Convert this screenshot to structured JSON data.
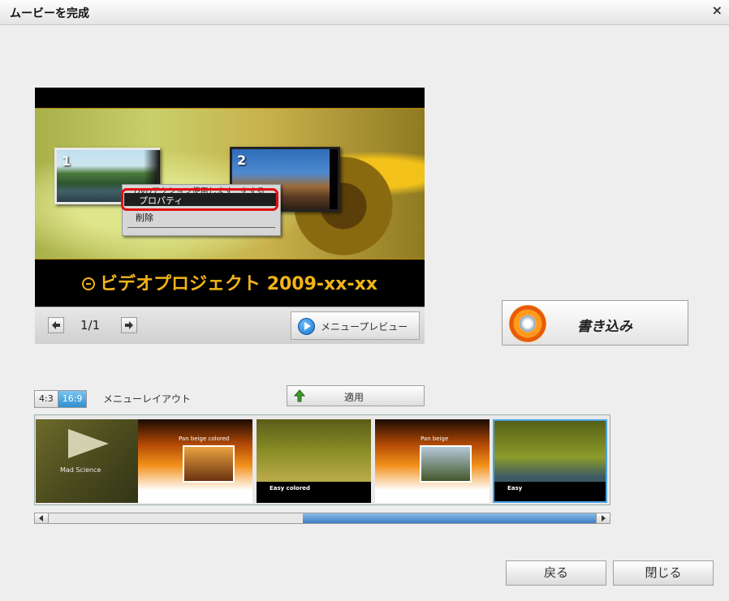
{
  "window": {
    "title": "ムービーを完成",
    "close_glyph": "×"
  },
  "preview": {
    "thumbnails": [
      {
        "number": "1"
      },
      {
        "number": "2"
      }
    ],
    "context_menu": {
      "items": [
        "DVDアクション使用します...をする",
        "プロパティ",
        "削除"
      ],
      "highlighted": "プロパティ"
    },
    "menu_title": "ビデオプロジェクト 2009-xx-xx",
    "page_indicator": "1/1",
    "menu_preview_label": "メニュープレビュー"
  },
  "burn": {
    "label": "書き込み",
    "icon": "burn-disc-icon"
  },
  "layout": {
    "aspect_options": [
      "4:3",
      "16:9"
    ],
    "aspect_selected": "16:9",
    "label": "メニューレイアウト",
    "apply_label": "適用"
  },
  "templates": [
    {
      "caption": "Mad Science"
    },
    {
      "caption": "Pan beige colored"
    },
    {
      "caption": "Easy colored"
    },
    {
      "caption": "Pan beige"
    },
    {
      "caption": "Easy",
      "selected": true
    }
  ],
  "footer": {
    "back_label": "戻る",
    "close_label": "閉じる"
  },
  "colors": {
    "accent": "#2f8fd0",
    "title_gold": "#f2b418",
    "highlight_ring": "#e01010"
  }
}
